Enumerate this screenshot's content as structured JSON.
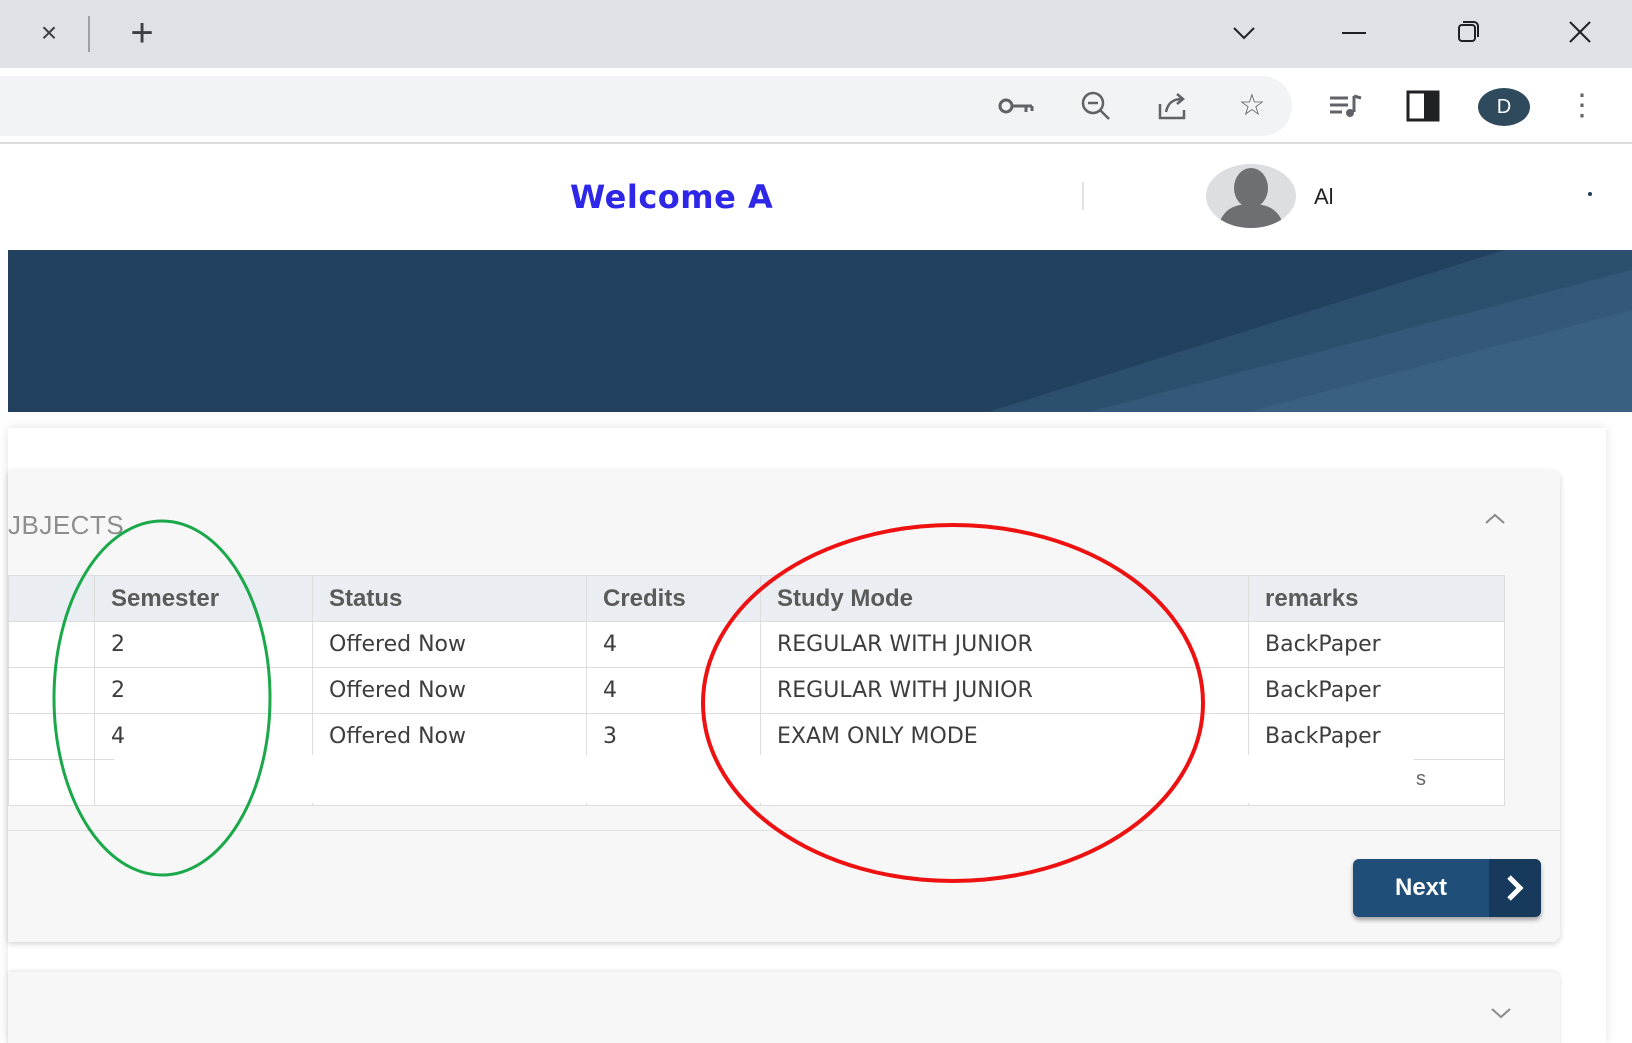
{
  "browser": {
    "tab_close_glyph": "×",
    "new_tab_glyph": "+",
    "profile_initial": "D",
    "window_close_glyph": "✕",
    "star_glyph": "☆",
    "menu_glyph": "⋮",
    "icons": [
      "tab-close-icon",
      "new-tab-icon",
      "tab-search-icon",
      "minimize-icon",
      "restore-icon",
      "window-close-icon",
      "key-icon",
      "zoom-out-icon",
      "share-icon",
      "star-icon",
      "media-control-icon",
      "side-panel-icon",
      "more-menu-icon"
    ]
  },
  "header": {
    "welcome": "Welcome A",
    "username": "Al",
    "welcome_color": "#2e27e8"
  },
  "panel": {
    "title": "JBJECTS",
    "columns": [
      "Semester",
      "Status",
      "Credits",
      "Study Mode",
      "remarks"
    ],
    "rows": [
      {
        "semester": "2",
        "status": "Offered Now",
        "credits": "4",
        "study_mode": "REGULAR WITH JUNIOR",
        "remarks": "BackPaper"
      },
      {
        "semester": "2",
        "status": "Offered Now",
        "credits": "4",
        "study_mode": "REGULAR WITH JUNIOR",
        "remarks": "BackPaper"
      },
      {
        "semester": "4",
        "status": "Offered Now",
        "credits": "3",
        "study_mode": "EXAM ONLY MODE",
        "remarks": "BackPaper"
      }
    ],
    "partial_text": "s",
    "next_label": "Next"
  },
  "colors": {
    "banner": "#22415e",
    "button": "#1f4e79",
    "annotation_green": "#1aa84a",
    "annotation_red": "#ee1111"
  }
}
